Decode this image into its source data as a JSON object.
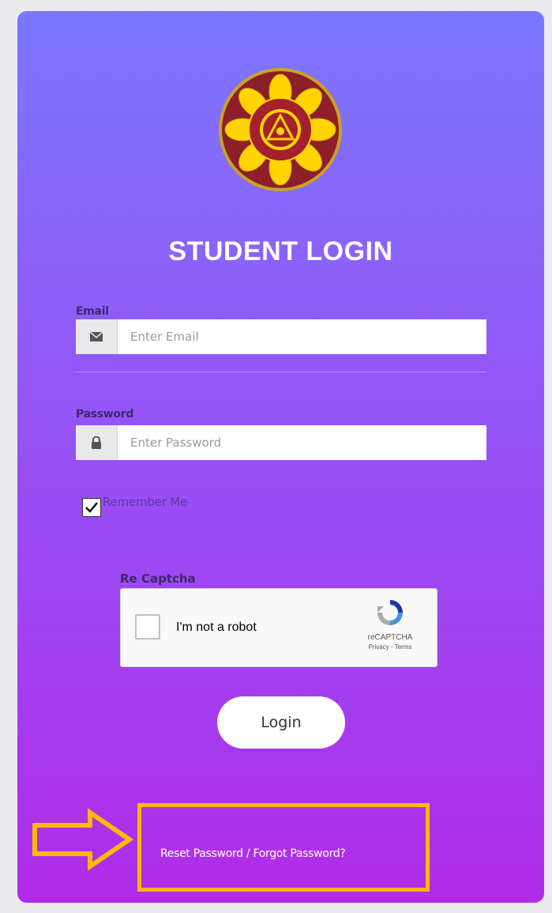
{
  "page": {
    "title": "STUDENT LOGIN"
  },
  "logo": {
    "icon": "institution-emblem-icon"
  },
  "email": {
    "label": "Email",
    "placeholder": "Enter Email",
    "value": "",
    "icon": "envelope-icon"
  },
  "password": {
    "label": "Password",
    "placeholder": "Enter Password",
    "value": "",
    "icon": "lock-icon"
  },
  "remember": {
    "label": "Remember Me",
    "checked": true
  },
  "captcha": {
    "label": "Re Captcha",
    "checkbox_text": "I'm not a robot",
    "brand": "reCAPTCHA",
    "links": "Privacy - Terms"
  },
  "login": {
    "label": "Login"
  },
  "reset": {
    "label": "Reset Password / Forgot Password?"
  },
  "colors": {
    "gradient_top": "#7b77ff",
    "gradient_bottom": "#b02ce8",
    "highlight": "#ffb800",
    "label_dark": "#3c2a6d"
  }
}
